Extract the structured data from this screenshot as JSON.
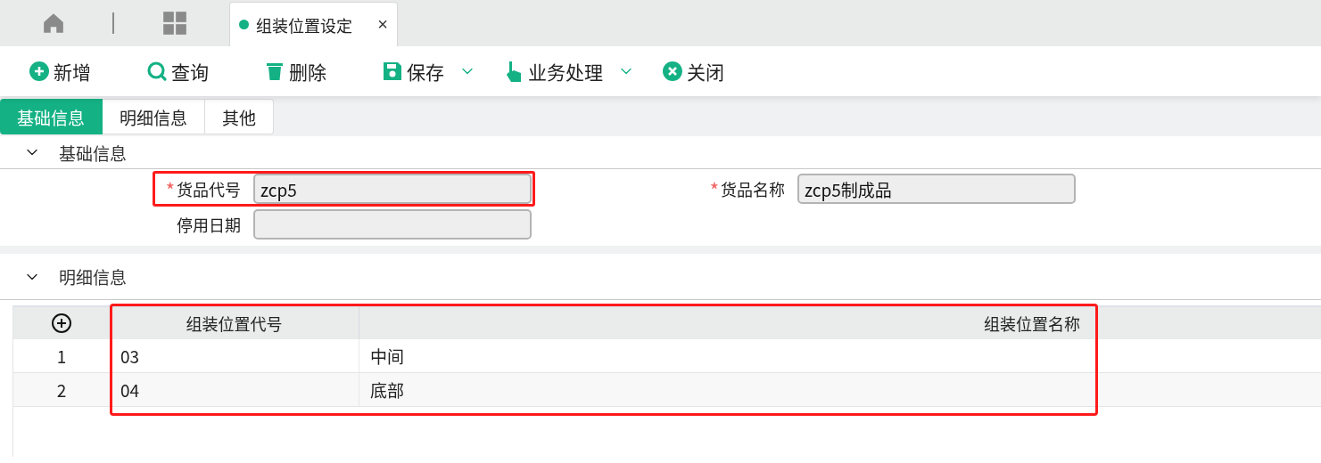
{
  "nav": {
    "tabs": [
      {
        "label": "组装位置设定",
        "selected": true,
        "close": "×"
      }
    ]
  },
  "toolbar": [
    {
      "label": "新增",
      "kind": "add",
      "dropdown": false
    },
    {
      "label": "查询",
      "kind": "search",
      "dropdown": false
    },
    {
      "label": "删除",
      "kind": "delete",
      "dropdown": false
    },
    {
      "label": "保存",
      "kind": "save",
      "dropdown": true
    },
    {
      "label": "业务处理",
      "kind": "hand",
      "dropdown": true
    },
    {
      "label": "关闭",
      "kind": "close",
      "dropdown": false
    }
  ],
  "section_tabs": [
    {
      "label": "基础信息",
      "selected": true
    },
    {
      "label": "明细信息",
      "selected": false
    },
    {
      "label": "其他",
      "selected": false
    }
  ],
  "basic_section": {
    "title": "基础信息",
    "expanded": true,
    "rows": [
      [
        {
          "label": "货品代号",
          "required_mark": "*",
          "value": "zcp5",
          "highlighted": true
        },
        {
          "label": "货品名称",
          "required_mark": "*",
          "value": "zcp5制成品"
        }
      ],
      [
        {
          "label": "停用日期"
        }
      ]
    ]
  },
  "detail_section": {
    "title": "明细信息",
    "expanded": true,
    "table": {
      "highlighted": true,
      "columns": [
        "组装位置代号",
        "组装位置名称"
      ],
      "rows": [
        {
          "index": "1",
          "cells": [
            "03",
            "中间"
          ]
        },
        {
          "index": "2",
          "cells": [
            "04",
            "底部"
          ]
        }
      ]
    }
  }
}
